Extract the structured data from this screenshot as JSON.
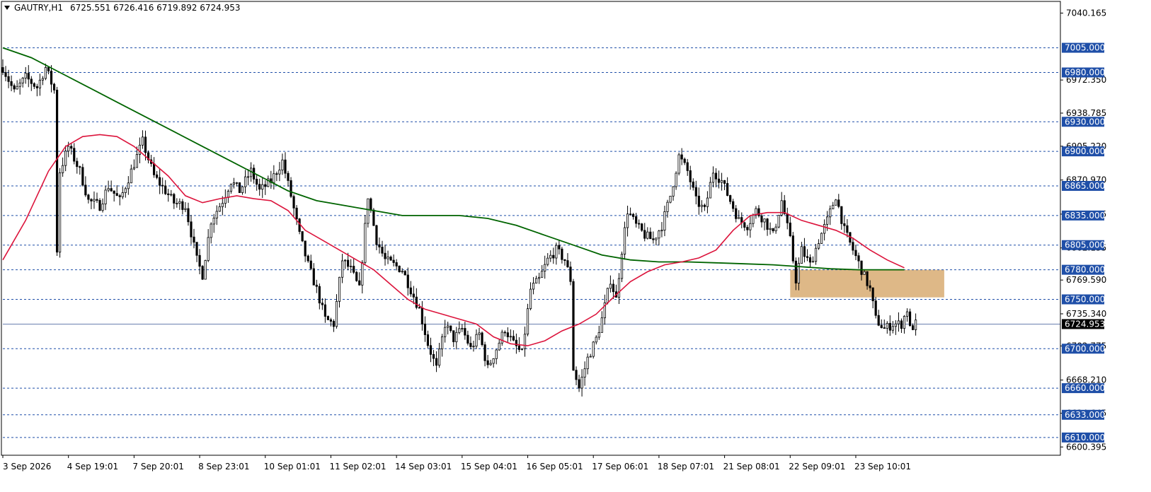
{
  "header": {
    "symbol": "GAUTRY,H1",
    "ohlc": "6725.551 6726.416 6719.892 6724.953"
  },
  "colors": {
    "candle": "#000000",
    "ma_fast": "#dc143c",
    "ma_slow": "#006400",
    "hline": "#1f4fa8",
    "zone": "#deb887",
    "current_price_bg": "#000000",
    "label_bg": "#1f4fa8"
  },
  "chart_data": {
    "type": "candlestick",
    "ylim": [
      6592,
      7052
    ],
    "price_ticks": [
      {
        "label": "7040.165",
        "value": 7040.165
      },
      {
        "label": "6972.350",
        "value": 6972.35
      },
      {
        "label": "6938.785",
        "value": 6938.785
      },
      {
        "label": "6905.220",
        "value": 6905.22
      },
      {
        "label": "6870.970",
        "value": 6870.97
      },
      {
        "label": "6836.405",
        "value": 6836.405
      },
      {
        "label": "6802.155",
        "value": 6802.155
      },
      {
        "label": "6769.590",
        "value": 6769.59
      },
      {
        "label": "6735.340",
        "value": 6735.34
      },
      {
        "label": "6702.775",
        "value": 6702.775
      },
      {
        "label": "6668.210",
        "value": 6668.21
      },
      {
        "label": "6634.645",
        "value": 6634.645
      },
      {
        "label": "6600.395",
        "value": 6600.395
      }
    ],
    "horizontal_levels": [
      {
        "label": "7005.000",
        "value": 7005
      },
      {
        "label": "6980.000",
        "value": 6980
      },
      {
        "label": "6930.000",
        "value": 6930
      },
      {
        "label": "6900.000",
        "value": 6900
      },
      {
        "label": "6865.000",
        "value": 6865
      },
      {
        "label": "6835.000",
        "value": 6835
      },
      {
        "label": "6805.000",
        "value": 6805
      },
      {
        "label": "6780.000",
        "value": 6780
      },
      {
        "label": "6750.000",
        "value": 6750
      },
      {
        "label": "6700.000",
        "value": 6700
      },
      {
        "label": "6660.000",
        "value": 6660
      },
      {
        "label": "6633.000",
        "value": 6633
      },
      {
        "label": "6610.000",
        "value": 6610
      }
    ],
    "current_price": {
      "label": "6724.953",
      "value": 6724.953
    },
    "zone": {
      "top": 6780,
      "bottom": 6752,
      "from_index": 276,
      "to_index": 330
    },
    "time_labels": [
      {
        "label": "3 Sep 2026",
        "index": 0
      },
      {
        "label": "4 Sep 19:01",
        "index": 23
      },
      {
        "label": "7 Sep 20:01",
        "index": 46
      },
      {
        "label": "8 Sep 23:01",
        "index": 69
      },
      {
        "label": "10 Sep 01:01",
        "index": 92
      },
      {
        "label": "11 Sep 02:01",
        "index": 115
      },
      {
        "label": "14 Sep 03:01",
        "index": 138
      },
      {
        "label": "15 Sep 04:01",
        "index": 161
      },
      {
        "label": "16 Sep 05:01",
        "index": 184
      },
      {
        "label": "17 Sep 06:01",
        "index": 207
      },
      {
        "label": "18 Sep 07:01",
        "index": 230
      },
      {
        "label": "21 Sep 08:01",
        "index": 253
      },
      {
        "label": "22 Sep 09:01",
        "index": 276
      },
      {
        "label": "23 Sep 10:01",
        "index": 299
      }
    ],
    "keypoints": [
      [
        0,
        6985
      ],
      [
        4,
        6960
      ],
      [
        8,
        6975
      ],
      [
        12,
        6965
      ],
      [
        15,
        6985
      ],
      [
        18,
        6962
      ],
      [
        19,
        6800
      ],
      [
        20,
        6880
      ],
      [
        23,
        6905
      ],
      [
        27,
        6880
      ],
      [
        30,
        6850
      ],
      [
        34,
        6845
      ],
      [
        37,
        6865
      ],
      [
        41,
        6850
      ],
      [
        45,
        6880
      ],
      [
        49,
        6910
      ],
      [
        53,
        6875
      ],
      [
        57,
        6860
      ],
      [
        60,
        6848
      ],
      [
        64,
        6845
      ],
      [
        68,
        6790
      ],
      [
        70,
        6775
      ],
      [
        73,
        6830
      ],
      [
        77,
        6850
      ],
      [
        80,
        6870
      ],
      [
        83,
        6860
      ],
      [
        87,
        6880
      ],
      [
        90,
        6860
      ],
      [
        94,
        6870
      ],
      [
        98,
        6890
      ],
      [
        101,
        6855
      ],
      [
        104,
        6815
      ],
      [
        107,
        6785
      ],
      [
        110,
        6760
      ],
      [
        113,
        6730
      ],
      [
        116,
        6725
      ],
      [
        119,
        6790
      ],
      [
        122,
        6780
      ],
      [
        125,
        6760
      ],
      [
        128,
        6855
      ],
      [
        131,
        6810
      ],
      [
        134,
        6790
      ],
      [
        137,
        6785
      ],
      [
        140,
        6780
      ],
      [
        143,
        6760
      ],
      [
        146,
        6740
      ],
      [
        149,
        6705
      ],
      [
        152,
        6680
      ],
      [
        155,
        6725
      ],
      [
        158,
        6710
      ],
      [
        161,
        6720
      ],
      [
        164,
        6700
      ],
      [
        167,
        6715
      ],
      [
        170,
        6680
      ],
      [
        173,
        6700
      ],
      [
        176,
        6720
      ],
      [
        179,
        6705
      ],
      [
        182,
        6695
      ],
      [
        185,
        6760
      ],
      [
        188,
        6770
      ],
      [
        191,
        6790
      ],
      [
        194,
        6800
      ],
      [
        197,
        6790
      ],
      [
        199,
        6770
      ],
      [
        200,
        6680
      ],
      [
        202,
        6660
      ],
      [
        205,
        6690
      ],
      [
        208,
        6710
      ],
      [
        210,
        6730
      ],
      [
        213,
        6770
      ],
      [
        215,
        6750
      ],
      [
        217,
        6800
      ],
      [
        219,
        6840
      ],
      [
        222,
        6825
      ],
      [
        225,
        6815
      ],
      [
        228,
        6810
      ],
      [
        231,
        6825
      ],
      [
        234,
        6855
      ],
      [
        237,
        6895
      ],
      [
        240,
        6880
      ],
      [
        243,
        6850
      ],
      [
        246,
        6840
      ],
      [
        249,
        6880
      ],
      [
        252,
        6870
      ],
      [
        255,
        6850
      ],
      [
        258,
        6830
      ],
      [
        261,
        6825
      ],
      [
        264,
        6840
      ],
      [
        267,
        6830
      ],
      [
        270,
        6815
      ],
      [
        273,
        6850
      ],
      [
        276,
        6810
      ],
      [
        278,
        6770
      ],
      [
        280,
        6800
      ],
      [
        283,
        6785
      ],
      [
        286,
        6810
      ],
      [
        289,
        6830
      ],
      [
        292,
        6855
      ],
      [
        295,
        6820
      ],
      [
        298,
        6800
      ],
      [
        301,
        6780
      ],
      [
        304,
        6760
      ],
      [
        306,
        6730
      ],
      [
        309,
        6720
      ],
      [
        312,
        6725
      ],
      [
        315,
        6725
      ],
      [
        317,
        6740
      ],
      [
        318,
        6720
      ],
      [
        320,
        6724.953
      ]
    ],
    "ma_fast_points": [
      [
        0,
        6790
      ],
      [
        8,
        6830
      ],
      [
        16,
        6880
      ],
      [
        22,
        6905
      ],
      [
        28,
        6915
      ],
      [
        34,
        6917
      ],
      [
        40,
        6915
      ],
      [
        46,
        6905
      ],
      [
        52,
        6890
      ],
      [
        58,
        6875
      ],
      [
        64,
        6855
      ],
      [
        70,
        6848
      ],
      [
        76,
        6852
      ],
      [
        82,
        6855
      ],
      [
        88,
        6852
      ],
      [
        94,
        6850
      ],
      [
        100,
        6840
      ],
      [
        106,
        6820
      ],
      [
        112,
        6810
      ],
      [
        118,
        6800
      ],
      [
        124,
        6790
      ],
      [
        130,
        6780
      ],
      [
        136,
        6765
      ],
      [
        142,
        6750
      ],
      [
        148,
        6740
      ],
      [
        154,
        6735
      ],
      [
        160,
        6730
      ],
      [
        166,
        6725
      ],
      [
        172,
        6712
      ],
      [
        178,
        6705
      ],
      [
        184,
        6703
      ],
      [
        190,
        6708
      ],
      [
        196,
        6718
      ],
      [
        202,
        6725
      ],
      [
        208,
        6735
      ],
      [
        214,
        6752
      ],
      [
        220,
        6768
      ],
      [
        226,
        6778
      ],
      [
        232,
        6785
      ],
      [
        238,
        6788
      ],
      [
        244,
        6792
      ],
      [
        250,
        6800
      ],
      [
        256,
        6820
      ],
      [
        262,
        6835
      ],
      [
        268,
        6838
      ],
      [
        274,
        6838
      ],
      [
        280,
        6830
      ],
      [
        286,
        6825
      ],
      [
        292,
        6820
      ],
      [
        298,
        6812
      ],
      [
        304,
        6800
      ],
      [
        310,
        6790
      ],
      [
        316,
        6782
      ]
    ],
    "ma_slow_points": [
      [
        0,
        7005
      ],
      [
        10,
        6995
      ],
      [
        20,
        6980
      ],
      [
        30,
        6965
      ],
      [
        40,
        6950
      ],
      [
        50,
        6935
      ],
      [
        60,
        6920
      ],
      [
        70,
        6905
      ],
      [
        80,
        6890
      ],
      [
        90,
        6875
      ],
      [
        100,
        6860
      ],
      [
        110,
        6850
      ],
      [
        120,
        6845
      ],
      [
        130,
        6840
      ],
      [
        140,
        6835
      ],
      [
        150,
        6835
      ],
      [
        160,
        6835
      ],
      [
        170,
        6832
      ],
      [
        180,
        6825
      ],
      [
        190,
        6815
      ],
      [
        200,
        6805
      ],
      [
        210,
        6795
      ],
      [
        220,
        6790
      ],
      [
        230,
        6788
      ],
      [
        240,
        6788
      ],
      [
        250,
        6787
      ],
      [
        260,
        6786
      ],
      [
        270,
        6785
      ],
      [
        280,
        6783
      ],
      [
        290,
        6781
      ],
      [
        300,
        6780
      ],
      [
        310,
        6780
      ],
      [
        316,
        6780
      ]
    ]
  }
}
